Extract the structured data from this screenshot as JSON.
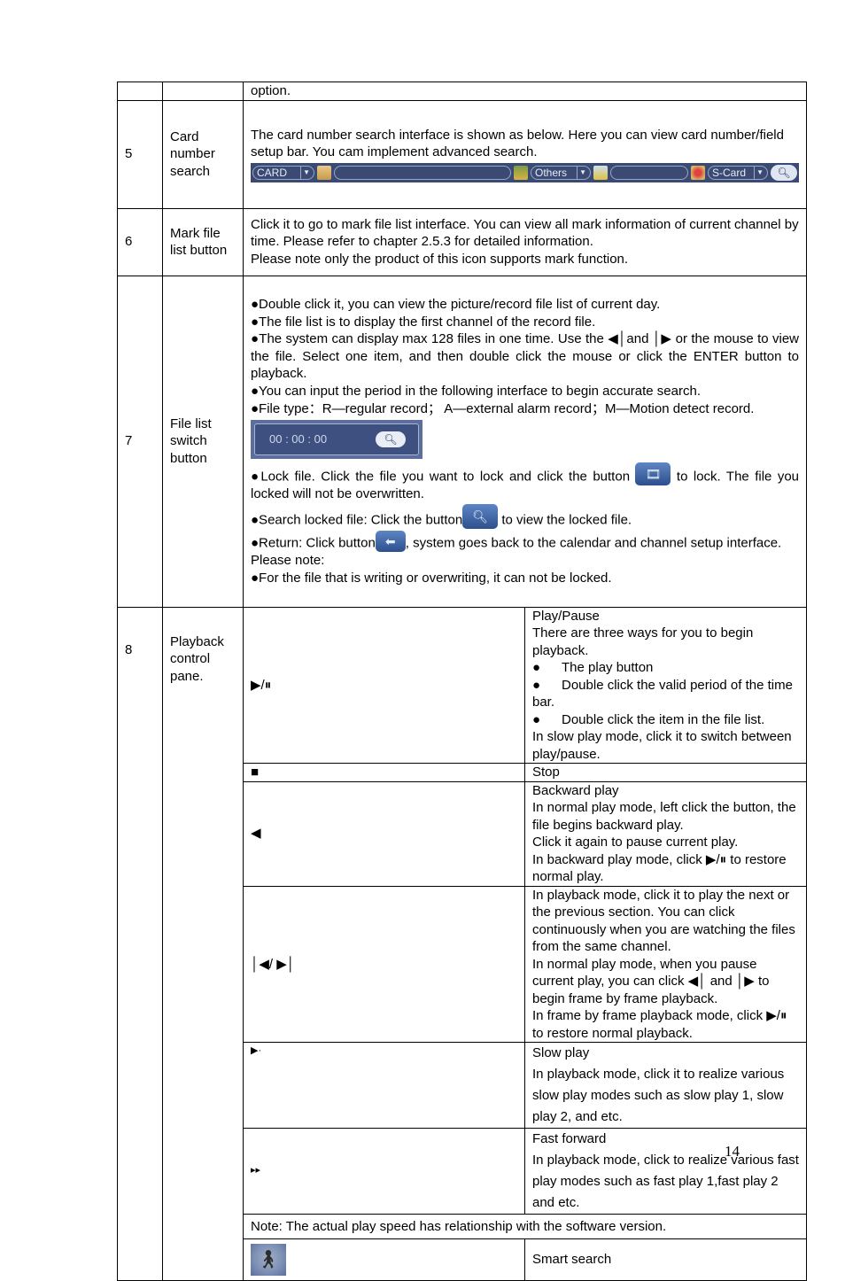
{
  "table": {
    "row_top": {
      "content": "option."
    },
    "row5": {
      "num": "5",
      "name": "Card number search",
      "desc": "The card number search interface is shown as below. Here you can view card number/field setup bar. You cam implement advanced search.",
      "bar": {
        "card_select": "CARD",
        "card_input": "",
        "others_select": "Others",
        "others_input": "",
        "scard_select": "S-Card",
        "search_icon": "search-icon"
      }
    },
    "row6": {
      "num": "6",
      "name": "Mark file list button",
      "lines": [
        "Click it to go to mark file list interface. You can view all mark information of current channel by time. Please refer to chapter 2.5.3 for detailed information.",
        "Please note only the product of this icon supports mark function."
      ]
    },
    "row7": {
      "num": "7",
      "name": "File list switch button",
      "b1": "●Double click it, you can view the picture/record file list of current day.",
      "b2": "●The file list is to display the first channel of the record file.",
      "b3": "●The system can display max 128 files in one time. Use the ◀│and │▶ or the mouse to view the file. Select one item, and then double click the mouse or click the ENTER button to playback.",
      "b4": "●You can input the period in the following interface to begin accurate search.",
      "b5": "●File type：R—regular record； A—external alarm record；M—Motion detect record.",
      "time_value": "00 : 00 : 00",
      "lock_pre": "●Lock file. Click the file you want to lock and click the button ",
      "lock_post": " to lock. The file you locked will not be overwritten.",
      "search_pre": "●Search locked file: Click the button",
      "search_post": " to view the locked file.",
      "return_pre": "●Return: Click button",
      "return_post": ", system goes back to the calendar and channel setup interface.",
      "note_title": "Please note:",
      "note": "●For the file that is writing or overwriting, it can not be locked."
    },
    "row8": {
      "num": "8",
      "name": "Playback control pane.",
      "controls": [
        {
          "symbol": "▶/⏸",
          "lines": [
            "Play/Pause",
            "There are three ways for you to begin playback."
          ],
          "bullets": [
            "The play button",
            "Double click the valid period of the time bar.",
            "Double click the item in the file list."
          ],
          "tail": "In slow play mode, click it to switch between play/pause."
        },
        {
          "symbol": "■",
          "lines": [
            "Stop"
          ]
        },
        {
          "symbol": "◀",
          "lines": [
            "Backward play",
            "In normal play mode, left click the button, the file begins backward play.",
            "Click it again to pause current play.",
            "In backward play mode, click ▶/⏸ to restore normal play."
          ]
        },
        {
          "symbol": "│◀/ ▶│",
          "lines": [
            "In playback mode, click it to play the next or the previous section. You can click continuously when you are watching the files from the same channel.",
            "In normal play mode, when you pause current play, you can click ◀│ and │▶ to begin frame by frame playback.",
            "In frame by frame playback mode, click ▶/⏸ to restore normal playback."
          ]
        },
        {
          "symbol": "▶·",
          "lines": [
            "Slow play",
            "In playback mode, click it to realize various slow play modes such as slow play 1, slow play 2, and etc."
          ]
        },
        {
          "symbol": "▸▸",
          "lines": [
            "Fast forward",
            "In playback mode, click to realize various fast play modes such as  fast play 1,fast play 2 and etc."
          ]
        }
      ],
      "note": "Note: The actual play speed has relationship with the software version.",
      "smart_search": "Smart search"
    }
  },
  "page_number": "14"
}
